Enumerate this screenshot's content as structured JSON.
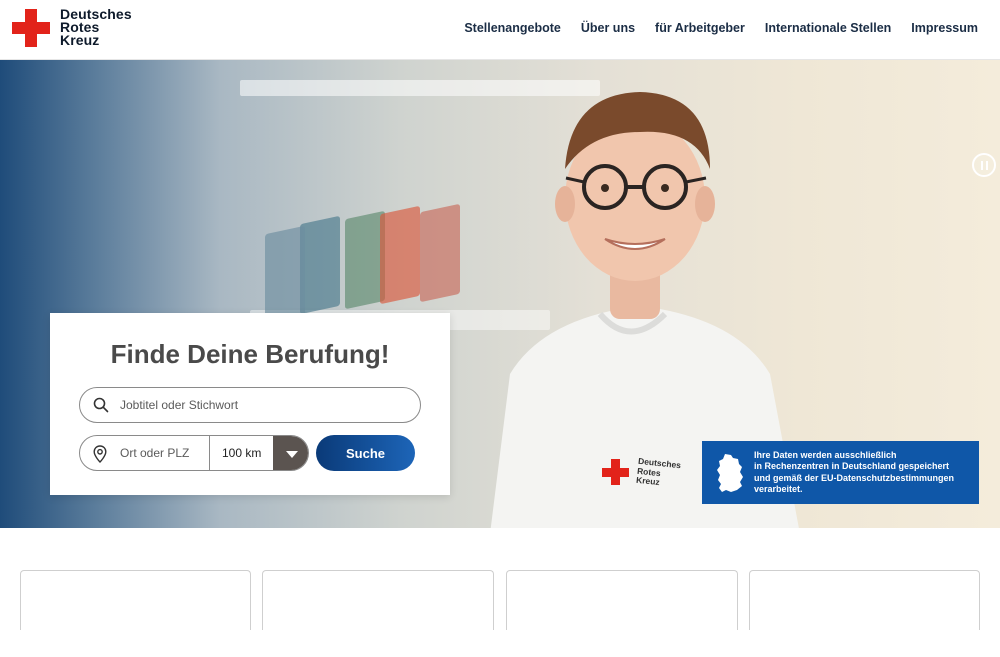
{
  "brand": {
    "name_line1": "Deutsches",
    "name_line2": "Rotes",
    "name_line3": "Kreuz",
    "cross_color": "#e2231a"
  },
  "nav": {
    "items": [
      {
        "label": "Stellenangebote"
      },
      {
        "label": "Über uns"
      },
      {
        "label": "für Arbeitgeber"
      },
      {
        "label": "Internationale Stellen"
      },
      {
        "label": "Impressum"
      }
    ]
  },
  "hero": {
    "pause_icon": "pause-icon",
    "shirt_logo_line1": "Deutsches",
    "shirt_logo_line2": "Rotes",
    "shirt_logo_line3": "Kreuz"
  },
  "search": {
    "title": "Finde Deine Berufung!",
    "job_placeholder": "Jobtitel oder Stichwort",
    "location_placeholder": "Ort oder PLZ",
    "radius_value": "100 km",
    "submit_label": "Suche",
    "search_icon": "search-icon",
    "location_icon": "location-pin-icon",
    "button_color": "#0a3a78"
  },
  "data_notice": {
    "line1": "Ihre Daten werden ausschließlich",
    "line2": "in Rechenzentren in Deutschland gespeichert",
    "line3": "und gemäß der EU-Datenschutzbestimmungen",
    "line4": "verarbeitet.",
    "icon": "germany-map-icon",
    "background": "#0f57a8"
  }
}
